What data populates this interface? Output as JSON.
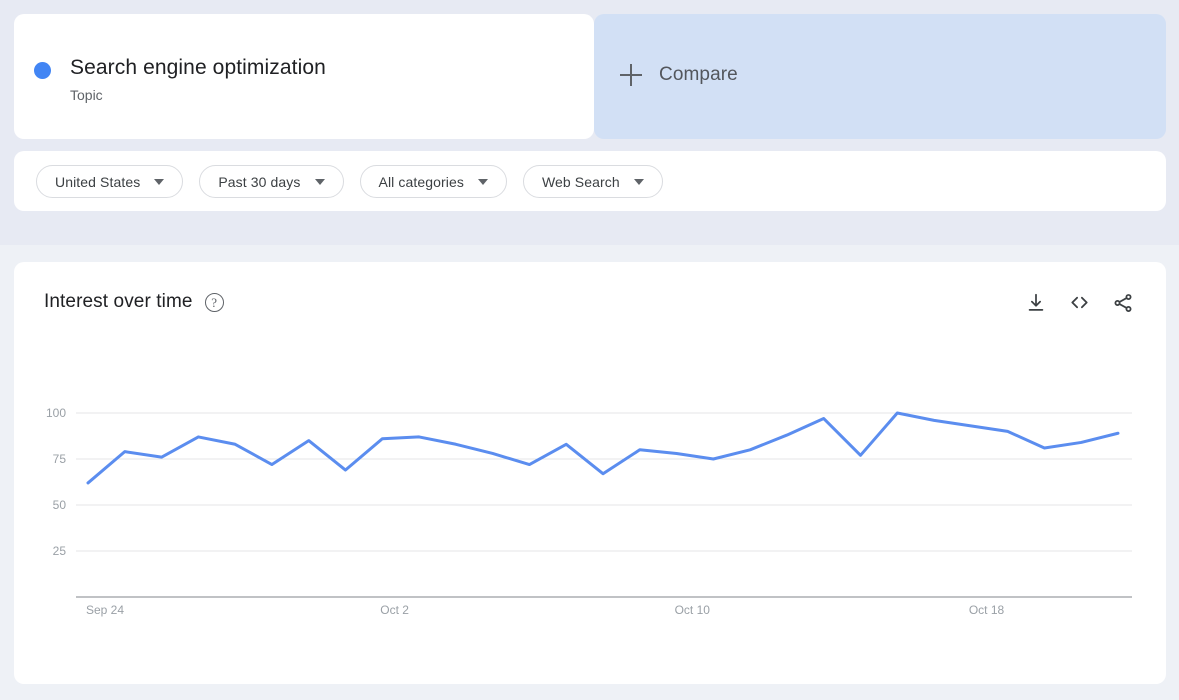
{
  "page": {
    "bg_top": "#e7eaf3",
    "bg_bottom": "#eef1f6",
    "accent": "#4285f4"
  },
  "term_card": {
    "title": "Search engine optimization",
    "subtitle": "Topic",
    "dot_color": "#4285f4"
  },
  "compare_card": {
    "label": "Compare",
    "plus_icon": "plus-icon",
    "bg": "#d2e0f5"
  },
  "filters": [
    {
      "label": "United States",
      "icon": "chevron-down-icon"
    },
    {
      "label": "Past 30 days",
      "icon": "chevron-down-icon"
    },
    {
      "label": "All categories",
      "icon": "chevron-down-icon"
    },
    {
      "label": "Web Search",
      "icon": "chevron-down-icon"
    }
  ],
  "chart_card": {
    "title": "Interest over time",
    "help_icon": "help-circle-icon",
    "help_glyph": "?",
    "actions": [
      {
        "name": "download-icon",
        "tooltip": "Download"
      },
      {
        "name": "embed-code-icon",
        "tooltip": "Embed"
      },
      {
        "name": "share-icon",
        "tooltip": "Share"
      }
    ]
  },
  "chart_data": {
    "type": "line",
    "title": "Interest over time",
    "xlabel": "",
    "ylabel": "",
    "ylim": [
      0,
      100
    ],
    "yticks": [
      25,
      50,
      75,
      100
    ],
    "grid": true,
    "legend": false,
    "line_color": "#5b8def",
    "xticks": [
      "Sep 24",
      "Oct 2",
      "Oct 10",
      "Oct 18"
    ],
    "xtick_index": [
      0,
      8,
      16,
      24
    ],
    "x": [
      "Sep 24",
      "Sep 25",
      "Sep 26",
      "Sep 27",
      "Sep 28",
      "Sep 29",
      "Sep 30",
      "Oct 1",
      "Oct 2",
      "Oct 3",
      "Oct 4",
      "Oct 5",
      "Oct 6",
      "Oct 7",
      "Oct 8",
      "Oct 9",
      "Oct 10",
      "Oct 11",
      "Oct 12",
      "Oct 13",
      "Oct 14",
      "Oct 15",
      "Oct 16",
      "Oct 17",
      "Oct 18",
      "Oct 19",
      "Oct 20",
      "Oct 21",
      "Oct 22"
    ],
    "values": [
      62,
      79,
      76,
      87,
      83,
      72,
      85,
      69,
      86,
      87,
      83,
      78,
      72,
      83,
      67,
      80,
      78,
      75,
      80,
      88,
      97,
      77,
      100,
      96,
      93,
      90,
      81,
      84,
      89
    ],
    "series": [
      {
        "name": "Search engine optimization",
        "color": "#5b8def",
        "values": [
          62,
          79,
          76,
          87,
          83,
          72,
          85,
          69,
          86,
          87,
          83,
          78,
          72,
          83,
          67,
          80,
          78,
          75,
          80,
          88,
          97,
          77,
          100,
          96,
          93,
          90,
          81,
          84,
          89
        ]
      }
    ]
  }
}
